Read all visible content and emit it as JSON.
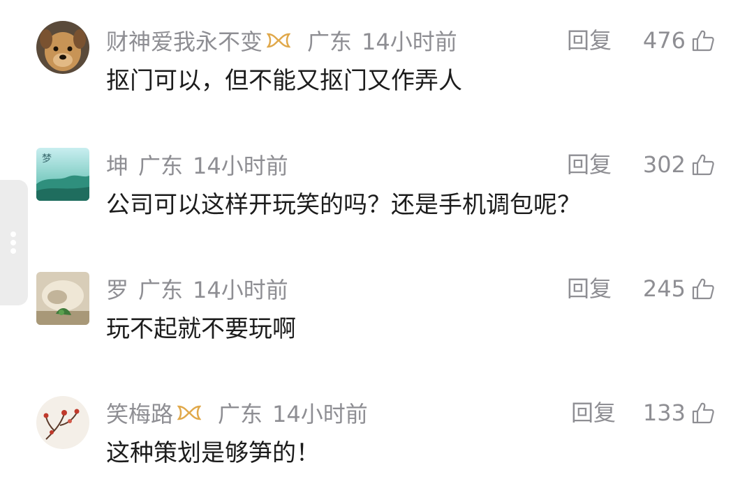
{
  "comments": [
    {
      "username": "财神爱我永不变",
      "badge_icon": "gold-ribbon-badge-icon",
      "location": "广东",
      "time": "14小时前",
      "reply_label": "回复",
      "likes": "476",
      "text": "抠门可以，但不能又抠门又作弄人"
    },
    {
      "username": "坤",
      "location": "广东",
      "time": "14小时前",
      "reply_label": "回复",
      "likes": "302",
      "text": "公司可以这样开玩笑的吗？还是手机调包呢？"
    },
    {
      "username": "罗",
      "location": "广东",
      "time": "14小时前",
      "reply_label": "回复",
      "likes": "245",
      "text": "玩不起就不要玩啊"
    },
    {
      "username": "笑梅路",
      "badge_icon": "gold-ribbon-badge-icon",
      "location": "广东",
      "time": "14小时前",
      "reply_label": "回复",
      "likes": "133",
      "text": "这种策划是够笋的！"
    }
  ],
  "avatar_1_text": "梦",
  "colors": {
    "meta_gray": "#8e8e93",
    "text_dark": "#1c1c1c",
    "badge_gold": "#e0a84a"
  }
}
